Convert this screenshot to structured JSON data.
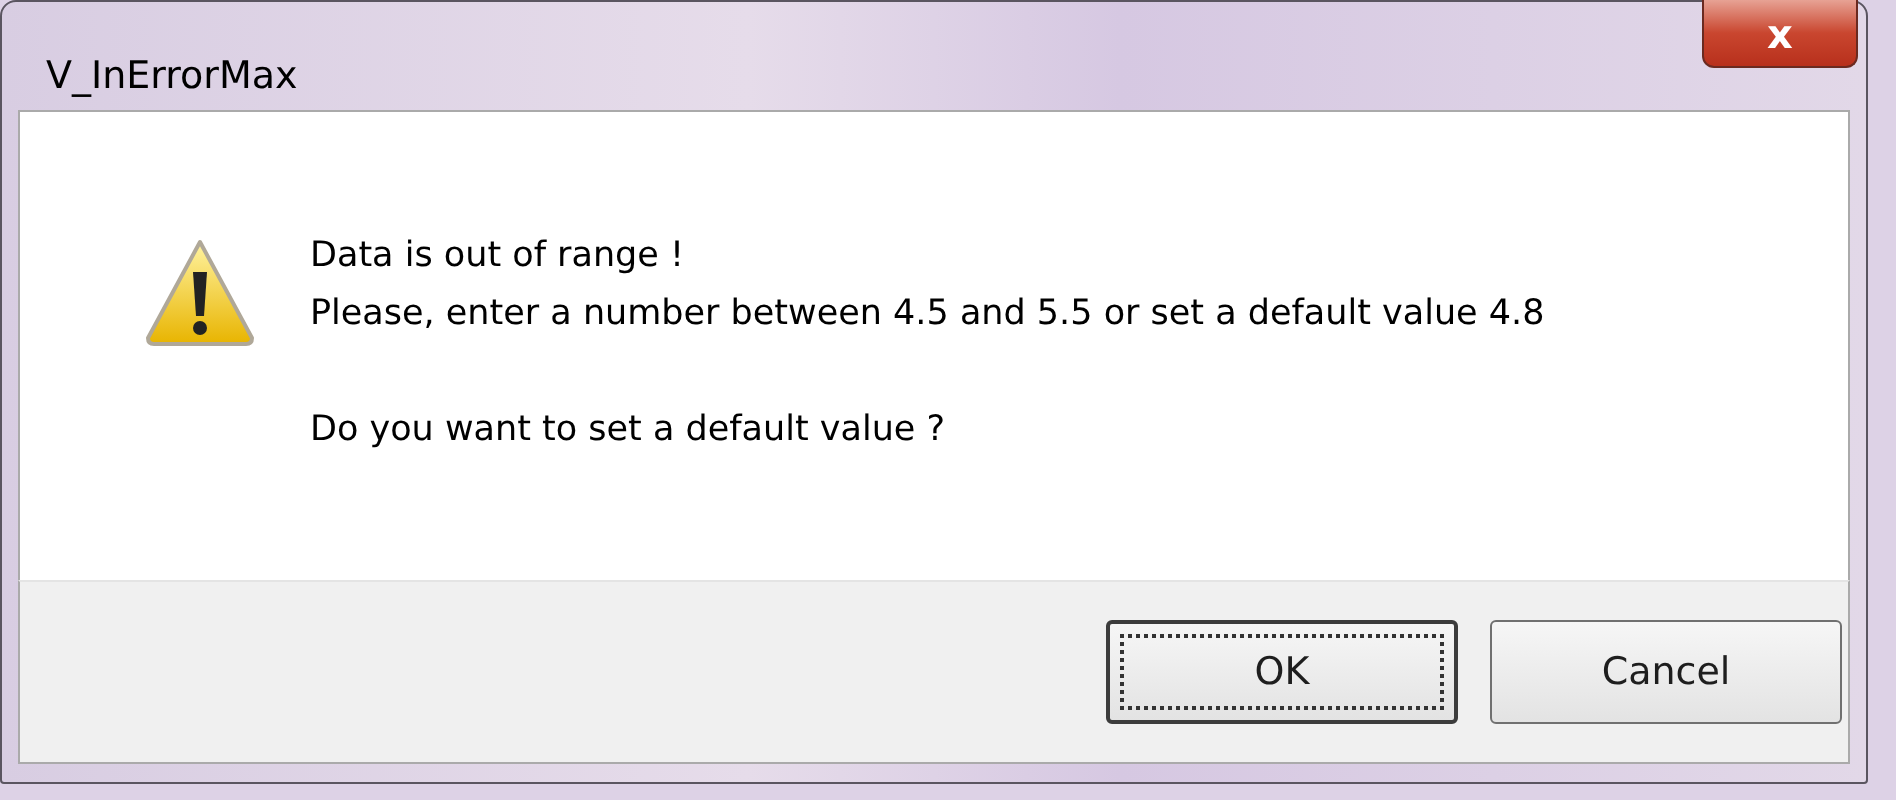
{
  "window": {
    "title": "V_InErrorMax",
    "close_label": "x"
  },
  "message": {
    "lines": [
      "Data is out of range !",
      "Please, enter a number between 4.5 and 5.5 or set a default value 4.8"
    ],
    "question": "Do you want to set a default value ?"
  },
  "buttons": [
    {
      "label": "OK",
      "focused": true
    },
    {
      "label": "Cancel",
      "focused": false
    }
  ]
}
